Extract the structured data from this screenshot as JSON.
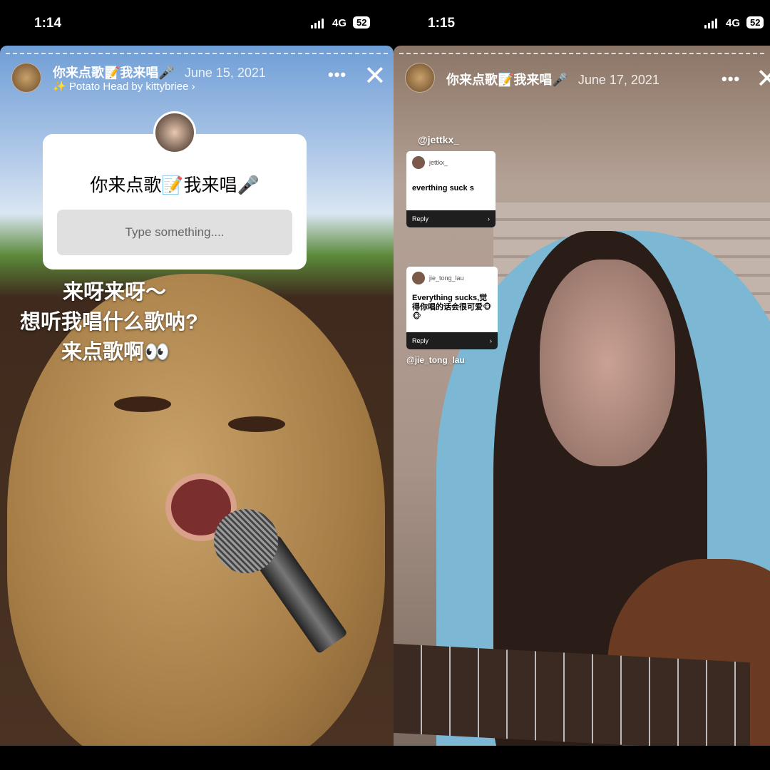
{
  "left": {
    "status": {
      "time": "1:14",
      "network": "4G",
      "battery": "52"
    },
    "header": {
      "title": "你来点歌📝我来唱🎤",
      "date": "June 15, 2021",
      "effect": "✨ Potato Head by kittybriee ›",
      "more": "•••",
      "close": "✕"
    },
    "question_sticker": {
      "title": "你来点歌📝我来唱🎤",
      "placeholder": "Type something...."
    },
    "overlay_lines": [
      "来呀来呀～",
      "想听我唱什么歌呐?",
      "来点歌啊👀"
    ]
  },
  "right": {
    "status": {
      "time": "1:15",
      "network": "4G",
      "battery": "52"
    },
    "header": {
      "title": "你来点歌📝我来唱🎤",
      "date": "June 17, 2021",
      "more": "•••",
      "close": "✕"
    },
    "responses": [
      {
        "mention": "@jettkx_",
        "username": "jettkx_",
        "text": "everthing suck s",
        "reply": "Reply",
        "chevron": "›"
      },
      {
        "mention": "@jie_tong_lau",
        "username": "jie_tong_lau",
        "text": "Everything sucks,觉得你唱的话会很可爱🐵🐵",
        "reply": "Reply",
        "chevron": "›"
      }
    ]
  }
}
